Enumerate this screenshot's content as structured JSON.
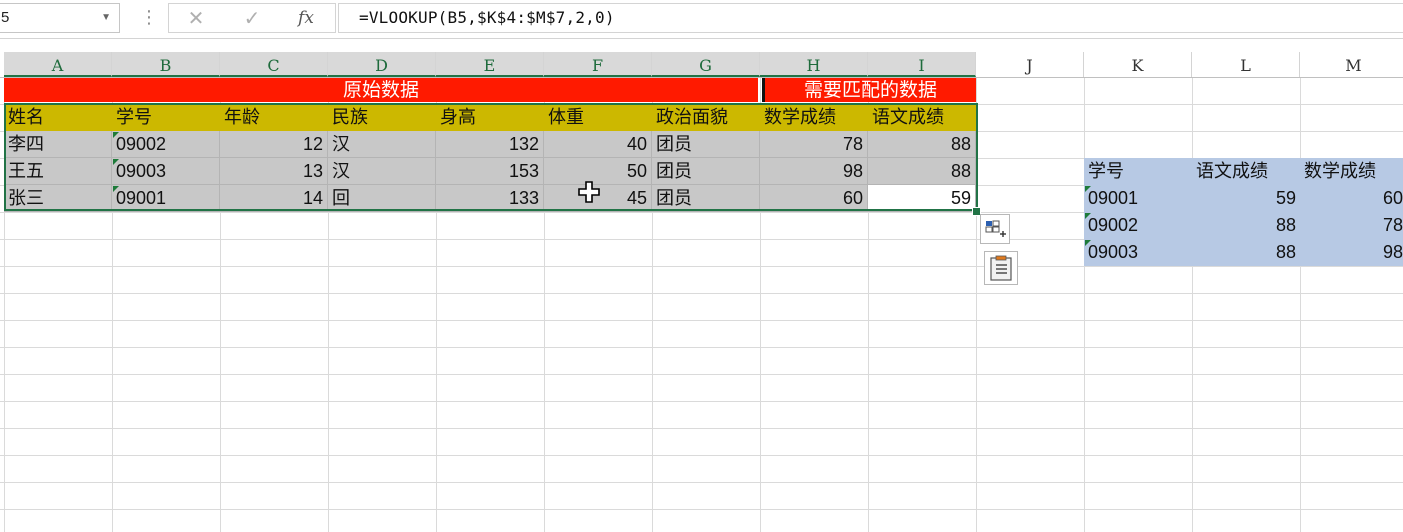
{
  "formula_bar": {
    "name_box": "5",
    "cancel_glyph": "✕",
    "enter_glyph": "✓",
    "fx_label": "fx",
    "formula": "=VLOOKUP(B5,$K$4:$M$7,2,0)"
  },
  "columns": [
    "A",
    "B",
    "C",
    "D",
    "E",
    "F",
    "G",
    "H",
    "I",
    "J",
    "K",
    "L",
    "M"
  ],
  "selected_columns": [
    "A",
    "B",
    "C",
    "D",
    "E",
    "F",
    "G",
    "H",
    "I"
  ],
  "colors": {
    "header_red": "#ff1a00",
    "header_yellow": "#ccb800",
    "data_gray": "#c8c8c8",
    "lookup_blue": "#b7c9e4",
    "selection_green": "#217346"
  },
  "main_table": {
    "title_left": "原始数据",
    "title_right": "需要匹配的数据",
    "headers": [
      "姓名",
      "学号",
      "年龄",
      "民族",
      "身高",
      "体重",
      "政治面貌",
      "数学成绩",
      "语文成绩"
    ],
    "rows": [
      [
        "李四",
        "09002",
        "12",
        "汉",
        "132",
        "40",
        "团员",
        "78",
        "88"
      ],
      [
        "王五",
        "09003",
        "13",
        "汉",
        "153",
        "50",
        "团员",
        "98",
        "88"
      ],
      [
        "张三",
        "09001",
        "14",
        "回",
        "133",
        "45",
        "团员",
        "60",
        "59"
      ]
    ]
  },
  "lookup_table": {
    "headers": [
      "学号",
      "语文成绩",
      "数学成绩"
    ],
    "rows": [
      [
        "09001",
        "59",
        "60"
      ],
      [
        "09002",
        "88",
        "78"
      ],
      [
        "09003",
        "88",
        "98"
      ]
    ]
  },
  "icons": {
    "quick_analysis": "quick-analysis-icon",
    "paste_options": "paste-options-icon",
    "cursor": "cross-cursor-icon"
  }
}
